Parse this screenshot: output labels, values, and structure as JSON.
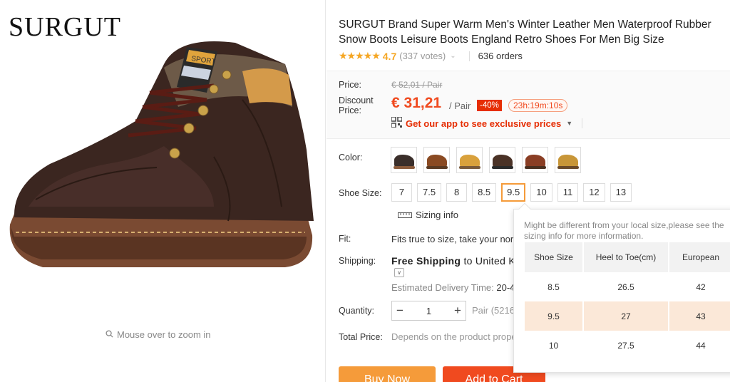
{
  "brand": "SURGUT",
  "gallery": {
    "zoom_hint": "Mouse over to zoom in"
  },
  "product": {
    "title": "SURGUT Brand Super Warm Men's Winter Leather Men Waterproof Rubber Snow Boots Leisure Boots England Retro Shoes For Men Big Size",
    "rating_stars": "★★★★★",
    "rating": "4.7",
    "votes": "(337 votes)",
    "orders": "636 orders"
  },
  "price": {
    "price_label": "Price:",
    "old_price": "€ 52,01 / Pair",
    "discount_label": "Discount Price:",
    "current_price": "€ 31,21",
    "per_unit": "/ Pair",
    "discount": "-40%",
    "countdown": "23h:19m:10s",
    "app_promo": "Get our app to see exclusive prices"
  },
  "options": {
    "color_label": "Color:",
    "colors": [
      {
        "name": "black",
        "shoe": "#3a2e2a",
        "sole": "#8a5a3a"
      },
      {
        "name": "brown",
        "shoe": "#8a4a22",
        "sole": "#5a3a22"
      },
      {
        "name": "yellow",
        "shoe": "#d9a13c",
        "sole": "#7a5a3a"
      },
      {
        "name": "dark-brown",
        "shoe": "#4a3226",
        "sole": "#2a2a2a"
      },
      {
        "name": "red-brown",
        "shoe": "#8a3e24",
        "sole": "#4a3020"
      },
      {
        "name": "tan",
        "shoe": "#c89638",
        "sole": "#6a4a2a"
      }
    ],
    "size_label": "Shoe Size:",
    "sizes": [
      "7",
      "7.5",
      "8",
      "8.5",
      "9.5",
      "10",
      "11",
      "12",
      "13"
    ],
    "selected_size": "9.5",
    "sizing_info": "Sizing info",
    "fit_label": "Fit:",
    "fit_text": "Fits true to size, take your norm",
    "shipping_label": "Shipping:",
    "shipping_bold": "Free Shipping",
    "shipping_rest": " to United K",
    "delivery_label": "Estimated Delivery Time: ",
    "delivery_value": "20-4",
    "quantity_label": "Quantity:",
    "quantity": "1",
    "availability": "Pair (5216",
    "total_label": "Total Price:",
    "total_value": "Depends on the product prope"
  },
  "buttons": {
    "buy_now": "Buy Now",
    "add_to_cart": "Add to Cart"
  },
  "size_popup": {
    "note": "Might be different from your local size,please see the sizing info for more information.",
    "headers": [
      "Shoe Size",
      "Heel to Toe(cm)",
      "European"
    ],
    "rows": [
      [
        "8.5",
        "26.5",
        "42"
      ],
      [
        "9.5",
        "27",
        "43"
      ],
      [
        "10",
        "27.5",
        "44"
      ]
    ]
  }
}
